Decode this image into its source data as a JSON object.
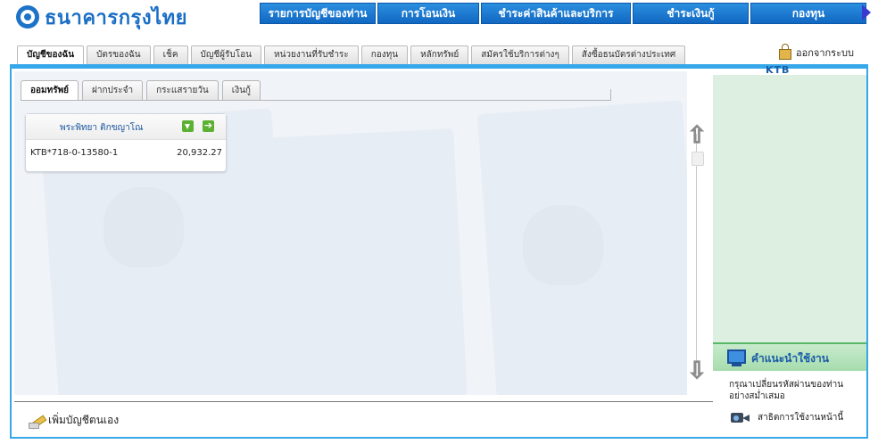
{
  "brand": {
    "name": "ธนาคารกรุงไทย",
    "mark": "KTB"
  },
  "topnav": {
    "items": [
      {
        "label": "รายการบัญชีของท่าน"
      },
      {
        "label": "การโอนเงิน"
      },
      {
        "label": "ชำระค่าสินค้าและบริการ"
      },
      {
        "label": "ชำระเงินกู้"
      },
      {
        "label": "กองทุน"
      }
    ]
  },
  "tabs": [
    {
      "label": "บัญชีของฉัน",
      "active": true
    },
    {
      "label": "บัตรของฉัน"
    },
    {
      "label": "เช็ค"
    },
    {
      "label": "บัญชีผู้รับโอน"
    },
    {
      "label": "หน่วยงานที่รับชำระ"
    },
    {
      "label": "กองทุน"
    },
    {
      "label": "หลักทรัพย์"
    },
    {
      "label": "สมัครใช้บริการต่างๆ"
    },
    {
      "label": "สั่งซื้อธนบัตรต่างประเทศ"
    }
  ],
  "logout": {
    "label": "ออกจากระบบ"
  },
  "subtabs": [
    {
      "label": "ออมทรัพย์",
      "active": true
    },
    {
      "label": "ฝากประจำ"
    },
    {
      "label": "กระแสรายวัน"
    },
    {
      "label": "เงินกู้"
    }
  ],
  "account_card": {
    "owner": "พระพิทยา ติกขญาโณ",
    "account_no": "KTB*718-0-13580-1",
    "balance": "20,932.27"
  },
  "add_account": {
    "label": "เพิ่มบัญชีตนเอง"
  },
  "help": {
    "title": "คำแนะนำใช้งาน",
    "text": "กรุณาเปลี่ยนรหัสผ่านของท่านอย่างสม่ำเสมอ",
    "demo_label": "สาธิตการใช้งานหน้านี้"
  },
  "colors": {
    "brand_blue": "#1a6fc5",
    "frame_border": "#36a7e8",
    "help_green": "#a6dcae",
    "action_green": "#5cb133"
  }
}
